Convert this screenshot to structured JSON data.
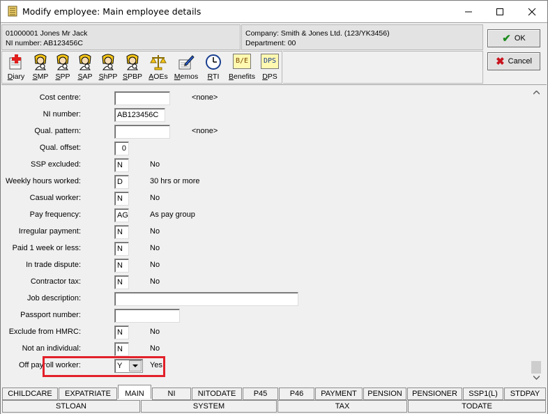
{
  "window": {
    "title": "Modify employee: Main employee details"
  },
  "header": {
    "employee_line1": "01000001 Jones Mr Jack",
    "employee_line2": "NI number: AB123456C",
    "company_line1": "Company: Smith & Jones Ltd. (123/YK3456)",
    "company_line2": "Department: 00"
  },
  "toolbar": {
    "items": [
      {
        "label": "Diary",
        "u": "D",
        "rest": "iary",
        "icon": "diary-icon"
      },
      {
        "label": "SMP",
        "u": "S",
        "rest": "MP",
        "icon": "smp-person-icon"
      },
      {
        "label": "SPP",
        "u": "S",
        "rest": "PP",
        "icon": "spp-person-icon"
      },
      {
        "label": "SAP",
        "u": "S",
        "rest": "AP",
        "icon": "sap-person-icon"
      },
      {
        "label": "ShPP",
        "u": "S",
        "rest": "hPP",
        "icon": "shpp-person-icon"
      },
      {
        "label": "SPBP",
        "u": "S",
        "rest": "PBP",
        "icon": "spbp-person-icon"
      },
      {
        "label": "AOEs",
        "u": "A",
        "rest": "OEs",
        "icon": "scales-icon"
      },
      {
        "label": "Memos",
        "u": "M",
        "rest": "emos",
        "icon": "memo-pen-icon"
      },
      {
        "label": "RTI",
        "u": "R",
        "rest": "TI",
        "icon": "clock-icon"
      },
      {
        "label": "Benefits",
        "u": "B",
        "rest": "enefits",
        "icon": "be-icon",
        "icon_text": "B/E"
      },
      {
        "label": "DPS",
        "u": "D",
        "rest": "PS",
        "icon": "dps-icon",
        "icon_text": "DPS"
      }
    ]
  },
  "buttons": {
    "ok": "OK",
    "cancel": "Cancel"
  },
  "form": {
    "rows": [
      {
        "label": "Cost centre:",
        "value": "",
        "desc": "<none>"
      },
      {
        "label": "NI number:",
        "value": "AB123456C",
        "desc": ""
      },
      {
        "label": "Qual. pattern:",
        "value": "",
        "desc": "<none>"
      },
      {
        "label": "Qual. offset:",
        "value": "0",
        "desc": ""
      },
      {
        "label": "SSP excluded:",
        "value": "N",
        "desc": "No"
      },
      {
        "label": "Weekly hours worked:",
        "value": "D",
        "desc": "30 hrs or more"
      },
      {
        "label": "Casual worker:",
        "value": "N",
        "desc": "No"
      },
      {
        "label": "Pay frequency:",
        "value": "AG",
        "desc": "As pay group"
      },
      {
        "label": "Irregular payment:",
        "value": "N",
        "desc": "No"
      },
      {
        "label": "Paid 1 week or less:",
        "value": "N",
        "desc": "No"
      },
      {
        "label": "In trade dispute:",
        "value": "N",
        "desc": "No"
      },
      {
        "label": "Contractor tax:",
        "value": "N",
        "desc": "No"
      },
      {
        "label": "Job description:",
        "value": "",
        "desc": ""
      },
      {
        "label": "Passport number:",
        "value": "",
        "desc": ""
      },
      {
        "label": "Exclude from HMRC:",
        "value": "N",
        "desc": "No"
      },
      {
        "label": "Not an individual:",
        "value": "N",
        "desc": "No"
      },
      {
        "label": "Off payroll worker:",
        "value": "Y",
        "desc": "Yes"
      }
    ]
  },
  "tabs": {
    "row1": [
      "CHILDCARE",
      "EXPATRIATE",
      "MAIN",
      "NI",
      "NITODATE",
      "P45",
      "P46",
      "PAYMENT",
      "PENSION",
      "PENSIONER",
      "SSP1(L)",
      "STDPAY"
    ],
    "row2": [
      "STLOAN",
      "SYSTEM",
      "TAX",
      "TODATE"
    ],
    "active": "MAIN"
  },
  "colors": {
    "highlight": "#e2202a",
    "ok_check": "#1e8c1e",
    "cancel_x": "#c8141e"
  }
}
